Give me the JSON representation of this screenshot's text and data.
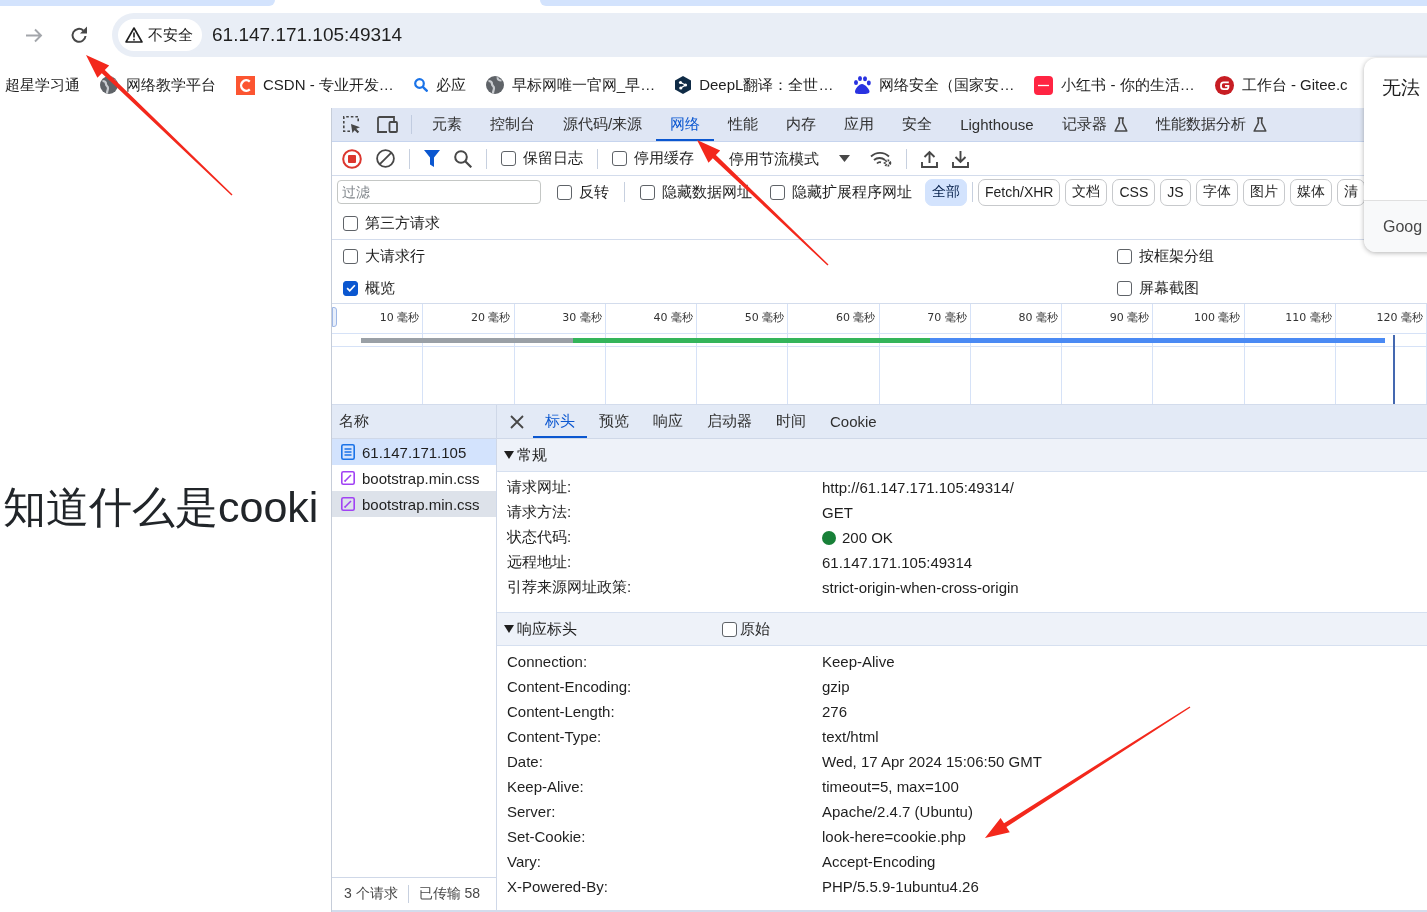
{
  "browser": {
    "security_label": "不安全",
    "url": "61.147.171.105:49314"
  },
  "bookmarks": [
    {
      "label": "超星学习通",
      "kind": "none"
    },
    {
      "label": "网络教学平台",
      "kind": "globe"
    },
    {
      "label": "CSDN - 专业开发…",
      "kind": "arctile"
    },
    {
      "label": "必应",
      "kind": "magnifier"
    },
    {
      "label": "早标网唯一官网_早…",
      "kind": "globe"
    },
    {
      "label": "DeepL翻译：全世…",
      "kind": "hexagon"
    },
    {
      "label": "网络安全（国家安…",
      "kind": "paw"
    },
    {
      "label": "小红书 - 你的生活…",
      "kind": "tile"
    },
    {
      "label": "工作台 - Gitee.c",
      "kind": "gcircle"
    }
  ],
  "page": {
    "heading": "知道什么是cooki"
  },
  "popup": {
    "title": "无法",
    "footer": "Goog"
  },
  "devtools": {
    "tabs": [
      {
        "label": "元素",
        "kind": "panel",
        "selected": false
      },
      {
        "label": "控制台",
        "kind": "panel",
        "selected": false
      },
      {
        "label": "源代码/来源",
        "kind": "panel",
        "selected": false
      },
      {
        "label": "网络",
        "kind": "panel",
        "selected": true
      },
      {
        "label": "性能",
        "kind": "panel",
        "selected": false
      },
      {
        "label": "内存",
        "kind": "panel",
        "selected": false
      },
      {
        "label": "应用",
        "kind": "panel",
        "selected": false
      },
      {
        "label": "安全",
        "kind": "panel",
        "selected": false
      },
      {
        "label": "Lighthouse",
        "kind": "panel",
        "selected": false
      },
      {
        "label": "记录器",
        "kind": "experiment",
        "selected": false
      },
      {
        "label": "性能数据分析",
        "kind": "experiment",
        "selected": false
      }
    ],
    "toolbar": {
      "recording": true,
      "options": [
        {
          "label": "保留日志",
          "checked": false
        },
        {
          "label": "停用缓存",
          "checked": false
        }
      ],
      "throttling": "停用节流模式"
    },
    "filter": {
      "placeholder": "过滤",
      "options": [
        {
          "label": "反转",
          "checked": false
        },
        {
          "label": "隐藏数据网址",
          "checked": false
        },
        {
          "label": "隐藏扩展程序网址",
          "checked": false
        }
      ],
      "types": [
        {
          "label": "全部",
          "selected": true
        },
        {
          "label": "Fetch/XHR",
          "selected": false
        },
        {
          "label": "文档",
          "selected": false
        },
        {
          "label": "CSS",
          "selected": false
        },
        {
          "label": "JS",
          "selected": false
        },
        {
          "label": "字体",
          "selected": false
        },
        {
          "label": "图片",
          "selected": false
        },
        {
          "label": "媒体",
          "selected": false
        },
        {
          "label": "清",
          "selected": false
        }
      ],
      "third_party": {
        "label": "第三方请求",
        "checked": false
      }
    },
    "settings": [
      {
        "label": "大请求行",
        "checked": false
      },
      {
        "label": "按框架分组",
        "checked": false
      },
      {
        "label": "概览",
        "checked": true
      },
      {
        "label": "屏幕截图",
        "checked": false
      }
    ],
    "timeline": {
      "ticks": [
        "10 毫秒",
        "20 毫秒",
        "30 毫秒",
        "40 毫秒",
        "50 毫秒",
        "60 毫秒",
        "70 毫秒",
        "80 毫秒",
        "90 毫秒",
        "100 毫秒",
        "110 毫秒",
        "120 毫秒"
      ]
    }
  },
  "requests": {
    "header": "名称",
    "rows": [
      {
        "name": "61.147.171.105",
        "kind": "document",
        "selected": true,
        "hovered": false
      },
      {
        "name": "bootstrap.min.css",
        "kind": "stylesheet",
        "selected": false,
        "hovered": false
      },
      {
        "name": "bootstrap.min.css",
        "kind": "stylesheet",
        "selected": false,
        "hovered": true
      }
    ],
    "summary": [
      "3 个请求",
      "已传输 58"
    ]
  },
  "details": {
    "tabs": [
      {
        "label": "标头",
        "selected": true
      },
      {
        "label": "预览",
        "selected": false
      },
      {
        "label": "响应",
        "selected": false
      },
      {
        "label": "启动器",
        "selected": false
      },
      {
        "label": "时间",
        "selected": false
      },
      {
        "label": "Cookie",
        "selected": false
      }
    ],
    "sections": [
      {
        "title": "常规",
        "expanded": true,
        "rows": [
          {
            "key": "请求网址:",
            "value": "http://61.147.171.105:49314/"
          },
          {
            "key": "请求方法:",
            "value": "GET"
          },
          {
            "key": "状态代码:",
            "value": "200 OK",
            "color": "#188038"
          },
          {
            "key": "远程地址:",
            "value": "61.147.171.105:49314"
          },
          {
            "key": "引荐来源网址政策:",
            "value": "strict-origin-when-cross-origin"
          }
        ]
      },
      {
        "title": "响应标头",
        "expanded": true,
        "raw": {
          "label": "原始",
          "checked": false
        },
        "rows": [
          {
            "key": "Connection:",
            "value": "Keep-Alive"
          },
          {
            "key": "Content-Encoding:",
            "value": "gzip"
          },
          {
            "key": "Content-Length:",
            "value": "276"
          },
          {
            "key": "Content-Type:",
            "value": "text/html"
          },
          {
            "key": "Date:",
            "value": "Wed, 17 Apr 2024 15:06:50 GMT"
          },
          {
            "key": "Keep-Alive:",
            "value": "timeout=5, max=100"
          },
          {
            "key": "Server:",
            "value": "Apache/2.4.7 (Ubuntu)"
          },
          {
            "key": "Set-Cookie:",
            "value": "look-here=cookie.php"
          },
          {
            "key": "Vary:",
            "value": "Accept-Encoding"
          },
          {
            "key": "X-Powered-By:",
            "value": "PHP/5.5.9-1ubuntu4.26"
          }
        ]
      }
    ]
  }
}
